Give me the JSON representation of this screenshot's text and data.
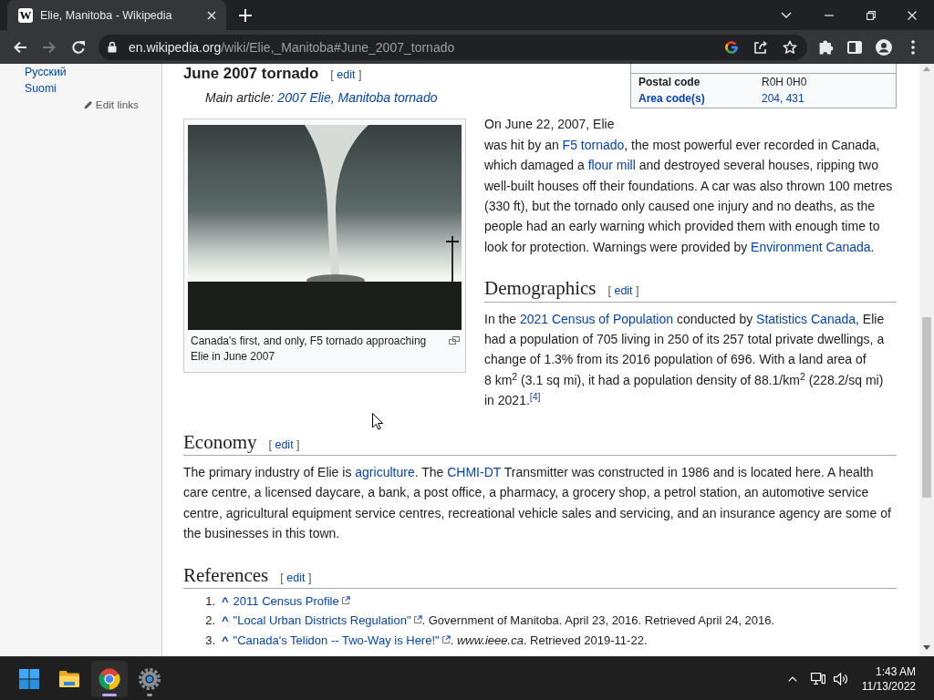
{
  "browser": {
    "tabs": [
      {
        "favicon": "W",
        "title": "Elie, Manitoba - Wikipedia",
        "selected": true
      }
    ],
    "navigation": [
      {
        "kind": "back",
        "disabled": false
      },
      {
        "kind": "forward",
        "disabled": true
      },
      {
        "kind": "reload",
        "disabled": false
      }
    ],
    "address": {
      "domain": "en.wikipedia.org",
      "path": "/wiki/Elie,_Manitoba#June_2007_tornado"
    }
  },
  "sidebar": {
    "languages": [
      "Русский",
      "Suomi"
    ],
    "edit_links": "Edit links"
  },
  "article": {
    "infobox": {
      "rows": [
        {
          "kind": "plain",
          "label": "Postal code",
          "value": "R0H 0H0"
        },
        {
          "kind": "link",
          "label": "Area code(s)",
          "value": "204, 431"
        }
      ]
    },
    "sections": [
      {
        "kind": "h3",
        "title": "June 2007 tornado",
        "edit": {
          "open": "[",
          "label": "edit",
          "close": "]"
        },
        "hatnote": [
          {
            "kind": "text",
            "text": "Main article: "
          },
          {
            "kind": "link",
            "text": "2007 Elie, Manitoba tornado"
          }
        ],
        "figure": {
          "caption": "Canada's first, and only, F5 tornado approaching Elie in June 2007"
        },
        "paragraphs": [
          [
            {
              "kind": "text",
              "text": "On June 22, 2007, Elie was hit by an "
            },
            {
              "kind": "link",
              "text": "F5 tornado"
            },
            {
              "kind": "text",
              "text": ", the most powerful ever recorded in Canada, which damaged a "
            },
            {
              "kind": "link",
              "text": "flour mill"
            },
            {
              "kind": "text",
              "text": " and destroyed several houses, ripping two well-built houses off their foundations. A car was also thrown 100 metres (330 ft), but the tornado only caused one injury and no deaths, as the people had an early warning which provided them with enough time to look for protection. Warnings were provided by "
            },
            {
              "kind": "link",
              "text": "Environment Canada"
            },
            {
              "kind": "text",
              "text": "."
            }
          ]
        ]
      },
      {
        "kind": "h2",
        "title": "Demographics",
        "edit": {
          "open": "[",
          "label": "edit",
          "close": "]"
        },
        "paragraphs": [
          [
            {
              "kind": "text",
              "text": "In the "
            },
            {
              "kind": "link",
              "text": "2021 Census of Population"
            },
            {
              "kind": "text",
              "text": " conducted by "
            },
            {
              "kind": "link",
              "text": "Statistics Canada"
            },
            {
              "kind": "text",
              "text": ", Elie had a population of 705 living in 250 of its 257 total private dwellings, a change of 1.3% from its 2016 population of 696. With a land area of 8 km$^{2}$ (3.1 sq mi), it had a population density of 88.1/km$^{2}$ (228.2/sq mi) in 2021."
            },
            {
              "kind": "link",
              "text": "$^{[4]}$"
            }
          ]
        ]
      },
      {
        "kind": "h2",
        "title": "Economy",
        "edit": {
          "open": "[",
          "label": "edit",
          "close": "]"
        },
        "paragraphs": [
          [
            {
              "kind": "text",
              "text": "The primary industry of Elie is "
            },
            {
              "kind": "link",
              "text": "agriculture"
            },
            {
              "kind": "text",
              "text": ". The "
            },
            {
              "kind": "link",
              "text": "CHMI-DT"
            },
            {
              "kind": "text",
              "text": " Transmitter was constructed in 1986 and is located here. A health care centre, a licensed daycare, a bank, a post office, a pharmacy, a grocery shop, a petrol station, an automotive service centre, agricultural equipment service centres, recreational vehicle sales and servicing, and an insurance agency are some of the businesses in this town."
            }
          ]
        ]
      },
      {
        "kind": "h2",
        "title": "References",
        "edit": {
          "open": "[",
          "label": "edit",
          "close": "]"
        },
        "references": [
          {
            "number": "1.",
            "backlink": "^",
            "runs": [
              {
                "kind": "link",
                "text": "2011 Census Profile",
                "external": true
              }
            ]
          },
          {
            "number": "2.",
            "backlink": "^",
            "runs": [
              {
                "kind": "link",
                "text": "\"Local Urban Districts Regulation\"",
                "external": true
              },
              {
                "kind": "text",
                "text": ". Government of Manitoba. April 23, 2016. Retrieved April 24, 2016."
              }
            ]
          },
          {
            "number": "3.",
            "backlink": "^",
            "runs": [
              {
                "kind": "link",
                "text": "\"Canada's Telidon -- Two-Way is Here!\"",
                "external": true
              },
              {
                "kind": "text",
                "text": ". *www.ieee.ca*. Retrieved 2019-11-22."
              }
            ]
          }
        ]
      }
    ]
  },
  "taskbar": {
    "apps": [
      {
        "kind": "start",
        "selected": false,
        "running": false
      },
      {
        "kind": "explorer",
        "selected": false,
        "running": false
      },
      {
        "kind": "chrome",
        "selected": true,
        "running": true
      },
      {
        "kind": "settings",
        "selected": false,
        "running": true
      }
    ],
    "time": "1:43 AM",
    "date": "11/13/2022"
  }
}
